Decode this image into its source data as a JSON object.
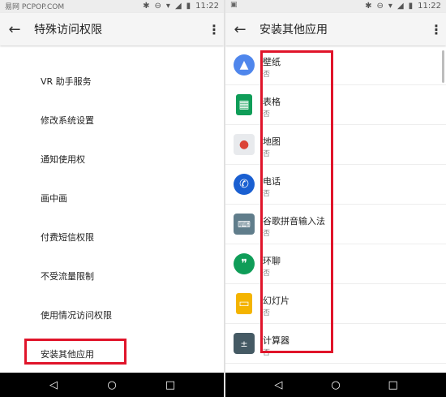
{
  "left": {
    "status_mark": "易网 PCPOP.COM",
    "time": "11:22",
    "title": "特殊访问权限",
    "items": [
      "VR 助手服务",
      "修改系统设置",
      "通知使用权",
      "画中画",
      "付费短信权限",
      "不受流量限制",
      "使用情况访问权限",
      "安装其他应用"
    ]
  },
  "right": {
    "time": "11:22",
    "title": "安装其他应用",
    "apps": [
      {
        "name": "壁纸",
        "sub": "否",
        "icon": "wallpaper-icon",
        "color": "#4f86ec"
      },
      {
        "name": "表格",
        "sub": "否",
        "icon": "sheets-icon",
        "color": "#0f9d58"
      },
      {
        "name": "地图",
        "sub": "否",
        "icon": "maps-icon",
        "color": "#e8eaed"
      },
      {
        "name": "电话",
        "sub": "否",
        "icon": "phone-icon",
        "color": "#1a5fd1"
      },
      {
        "name": "谷歌拼音输入法",
        "sub": "否",
        "icon": "pinyin-keyboard-icon",
        "color": "#607d8b"
      },
      {
        "name": "环聊",
        "sub": "否",
        "icon": "hangouts-icon",
        "color": "#0f9d58"
      },
      {
        "name": "幻灯片",
        "sub": "否",
        "icon": "slides-icon",
        "color": "#f4b400"
      },
      {
        "name": "计算器",
        "sub": "否",
        "icon": "calculator-icon",
        "color": "#455a64"
      }
    ]
  },
  "nav": {
    "back": "◁",
    "home": "○",
    "recents": "□"
  },
  "colors": {
    "highlight": "#e0142a"
  }
}
